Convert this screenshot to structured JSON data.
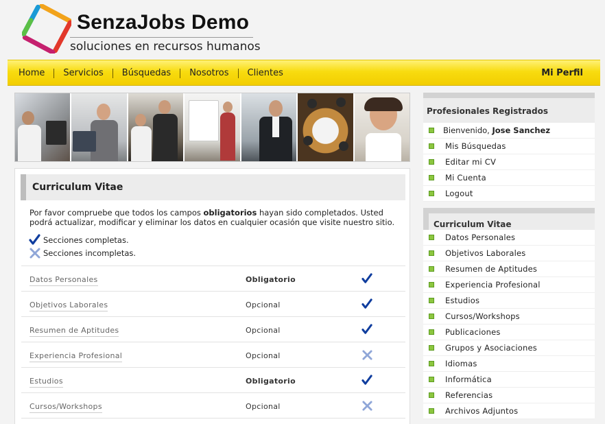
{
  "brand": {
    "title": "SenzaJobs Demo",
    "subtitle": "soluciones en recursos humanos"
  },
  "nav": {
    "items": [
      "Home",
      "Servicios",
      "Búsquedas",
      "Nosotros",
      "Clientes"
    ],
    "profile": "Mi Perfil"
  },
  "main": {
    "title": "Curriculum Vitae",
    "intro_before": "Por favor compruebe que todos los campos ",
    "intro_bold": "obligatorios",
    "intro_after": " hayan sido completados. Usted podrá actualizar, modificar y eliminar los datos en cualquier ocasión que visite nuestro sitio.",
    "legend_complete": "Secciones completas.",
    "legend_incomplete": "Secciones incompletas.",
    "rows": [
      {
        "section": "Datos Personales",
        "requirement": "Obligatorio",
        "status": "complete"
      },
      {
        "section": "Objetivos Laborales",
        "requirement": "Opcional",
        "status": "complete"
      },
      {
        "section": "Resumen de Aptitudes",
        "requirement": "Opcional",
        "status": "complete"
      },
      {
        "section": "Experiencia Profesional",
        "requirement": "Opcional",
        "status": "incomplete"
      },
      {
        "section": "Estudios",
        "requirement": "Obligatorio",
        "status": "complete"
      },
      {
        "section": "Cursos/Workshops",
        "requirement": "Opcional",
        "status": "incomplete"
      }
    ]
  },
  "sidebar": {
    "registered": {
      "title": "Profesionales Registrados",
      "welcome_prefix": "Bienvenido,",
      "user_name": "Jose Sanchez",
      "items": [
        "Mis Búsquedas",
        "Editar mi CV",
        "Mi Cuenta",
        "Logout"
      ]
    },
    "cv": {
      "title": "Curriculum Vitae",
      "items": [
        "Datos Personales",
        "Objetivos Laborales",
        "Resumen de Aptitudes",
        "Experiencia Profesional",
        "Estudios",
        "Cursos/Workshops",
        "Publicaciones",
        "Grupos y Asociaciones",
        "Idiomas",
        "Informática",
        "Referencias",
        "Archivos Adjuntos"
      ]
    }
  },
  "colors": {
    "nav_yellow": "#f8dc10",
    "bullet_green": "#8cc63f",
    "check_blue": "#0f3d9e",
    "cross_blue": "#8fa6d8"
  },
  "icons": {
    "complete": "check-icon",
    "incomplete": "cross-icon",
    "bullet": "square-bullet-icon"
  }
}
